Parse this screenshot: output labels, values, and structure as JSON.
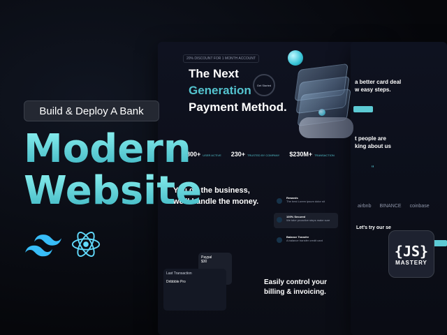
{
  "tag": {
    "label": "Build & Deploy A Bank"
  },
  "title": {
    "line1": "Modern",
    "line2": "Website"
  },
  "icons": {
    "tailwind": "tailwind-logo",
    "react": "react-logo"
  },
  "colors": {
    "accent": "#54c4cf",
    "title_top": "#8af0ef",
    "title_bottom": "#3fb6c3",
    "background": "#06070b"
  },
  "mockup": {
    "badge": "20% DISCOUNT FOR 1 MONTH ACCOUNT",
    "hero": {
      "line1": "The Next",
      "line2": "Generation",
      "line3": "Payment Method."
    },
    "get_started": "Get Started",
    "stats": [
      {
        "value": "3800+",
        "label": "USER ACTIVE"
      },
      {
        "value": "230+",
        "label": "TRUSTED BY COMPANY"
      },
      {
        "value": "$230M+",
        "label": "TRANSACTION"
      }
    ],
    "section2": {
      "line1": "You do the business,",
      "line2": "we'll handle the money."
    },
    "features": [
      {
        "title": "Rewards",
        "text": "The best Lorem ipsum dolor sit"
      },
      {
        "title": "100% Secured",
        "text": "We take proactive steps make sure"
      },
      {
        "title": "Balance Transfer",
        "text": "A balance transfer credit card"
      }
    ],
    "paypal": {
      "title": "Paypal",
      "amount": "$30"
    },
    "last_transaction": {
      "title": "Last Transaction",
      "item": "Dribbble Pro"
    },
    "control": {
      "line1": "Easily control your",
      "line2": "billing & invoicing."
    },
    "right": {
      "deal": {
        "line1": "a better card deal",
        "line2": "w easy steps."
      },
      "people": {
        "line1": "t people are",
        "line2": "king about us"
      },
      "logos": [
        "airbnb",
        "BINANCE",
        "coinbase"
      ],
      "try": "Let's try our se"
    }
  },
  "brand": {
    "top": "{JS}",
    "bottom": "MASTERY"
  }
}
